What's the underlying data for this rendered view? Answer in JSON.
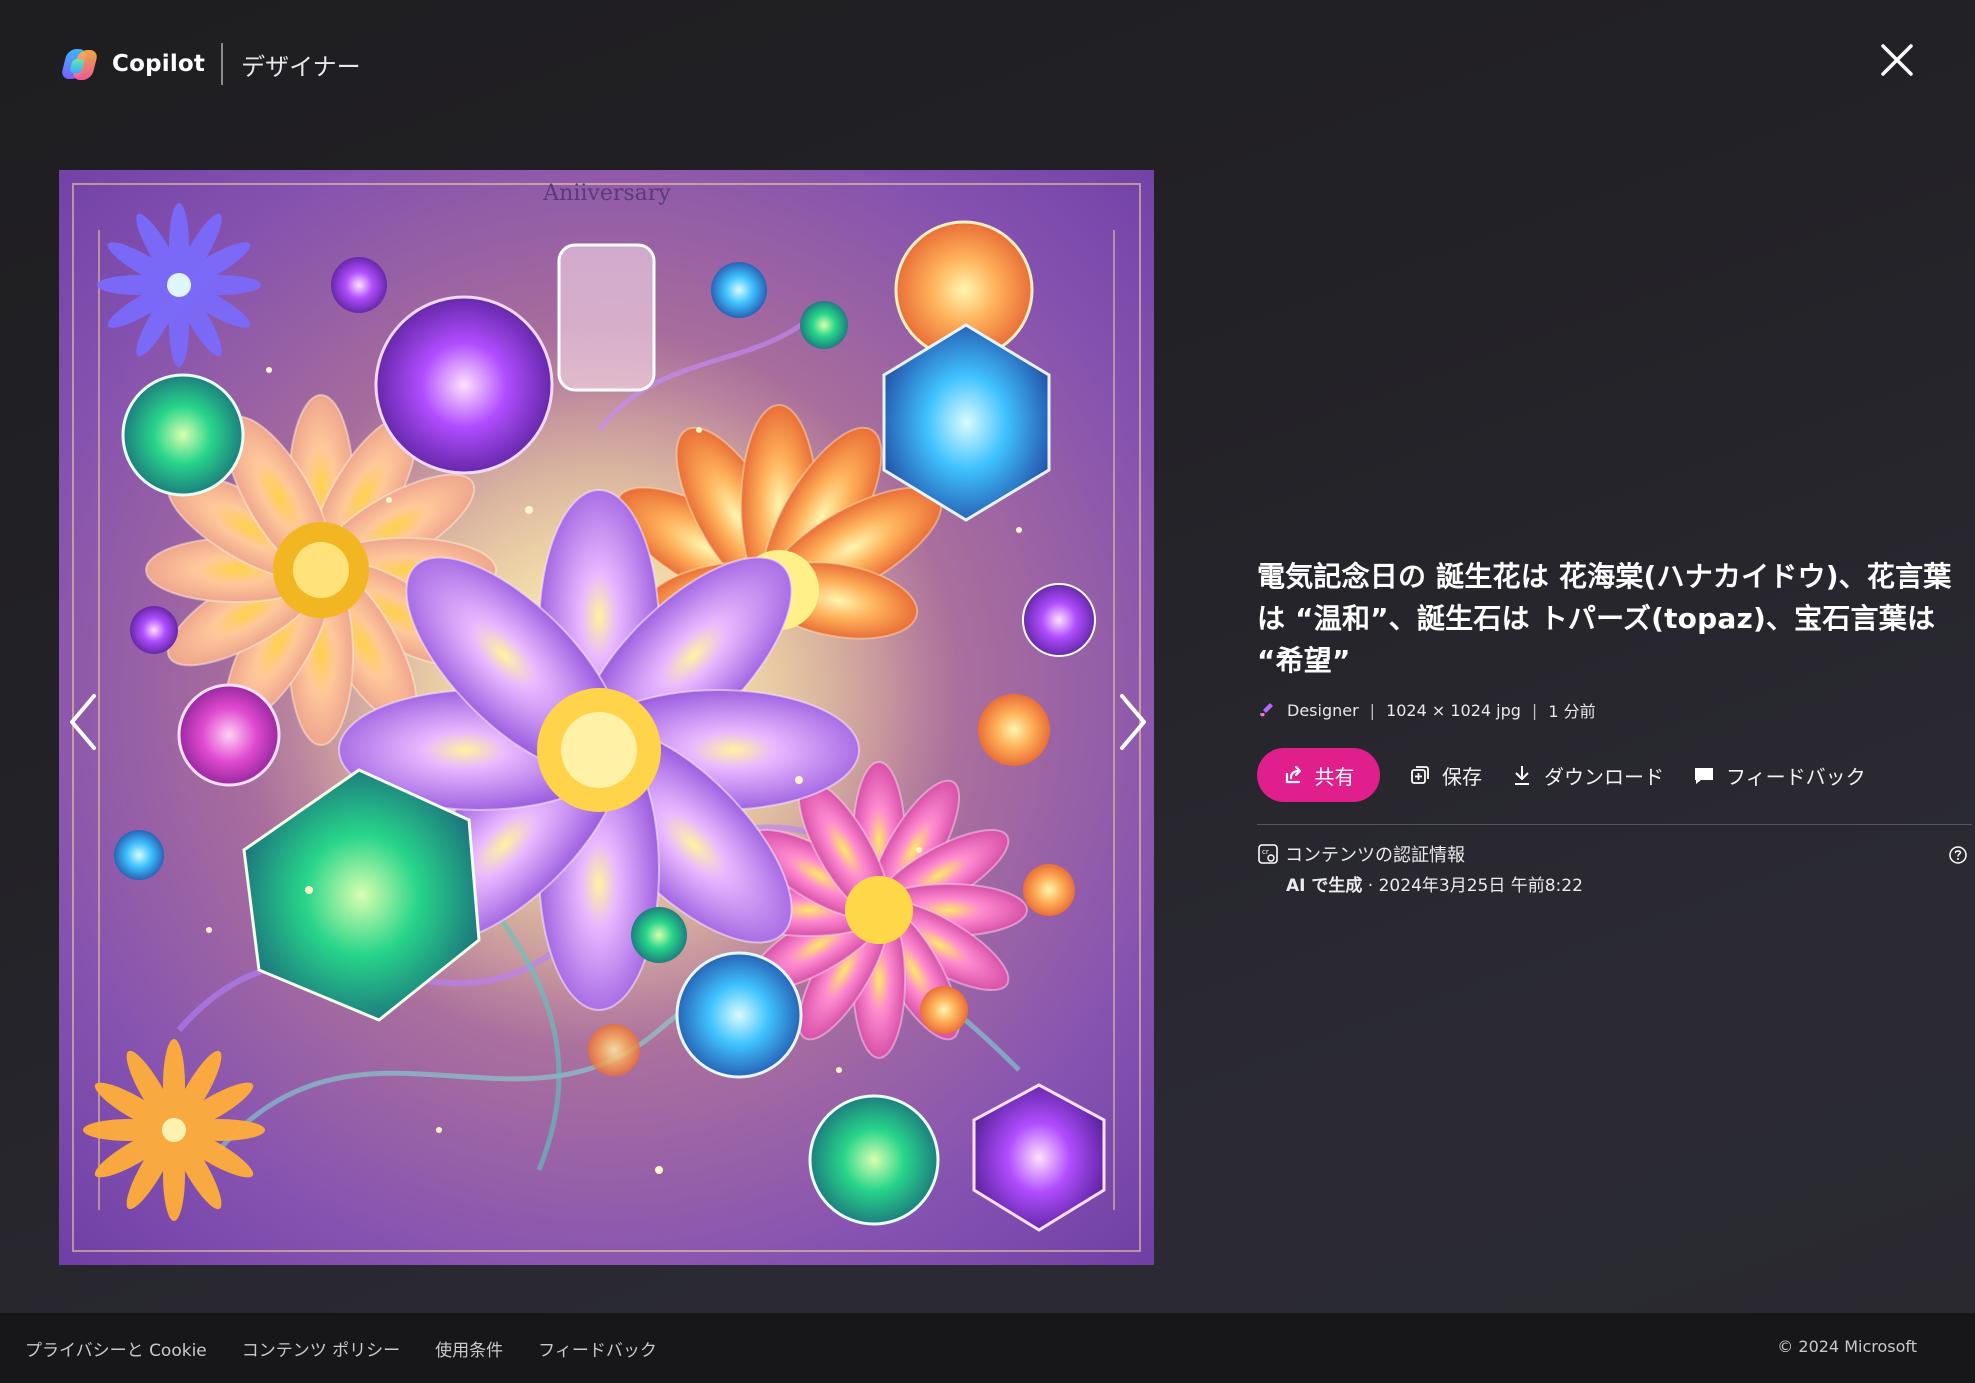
{
  "header": {
    "brand": "Copilot",
    "product": "デザイナー",
    "close_icon": "close-icon"
  },
  "image": {
    "caption_text": "Aniiversary",
    "prev_icon": "chevron-left-icon",
    "next_icon": "chevron-right-icon"
  },
  "details": {
    "title": "電気記念日の 誕生花は 花海棠(ハナカイドウ)、花言葉は “温和”、誕生石は トパーズ(topaz)、宝石言葉は “希望”",
    "source": "Designer",
    "dimensions": "1024 × 1024 jpg",
    "time_ago": "1 分前",
    "separator": "|"
  },
  "actions": {
    "share": "共有",
    "save": "保存",
    "download": "ダウンロード",
    "feedback": "フィードバック"
  },
  "credentials": {
    "heading": "コンテンツの認証情報",
    "generated_label": "AI で生成",
    "date": " · 2024年3月25日 午前8:22"
  },
  "footer": {
    "links": [
      "プライバシーと Cookie",
      "コンテンツ ポリシー",
      "使用条件",
      "フィードバック"
    ],
    "copyright": "© 2024 Microsoft"
  },
  "colors": {
    "accent": "#e01f8d",
    "background": "#232227",
    "footer": "#171719"
  }
}
